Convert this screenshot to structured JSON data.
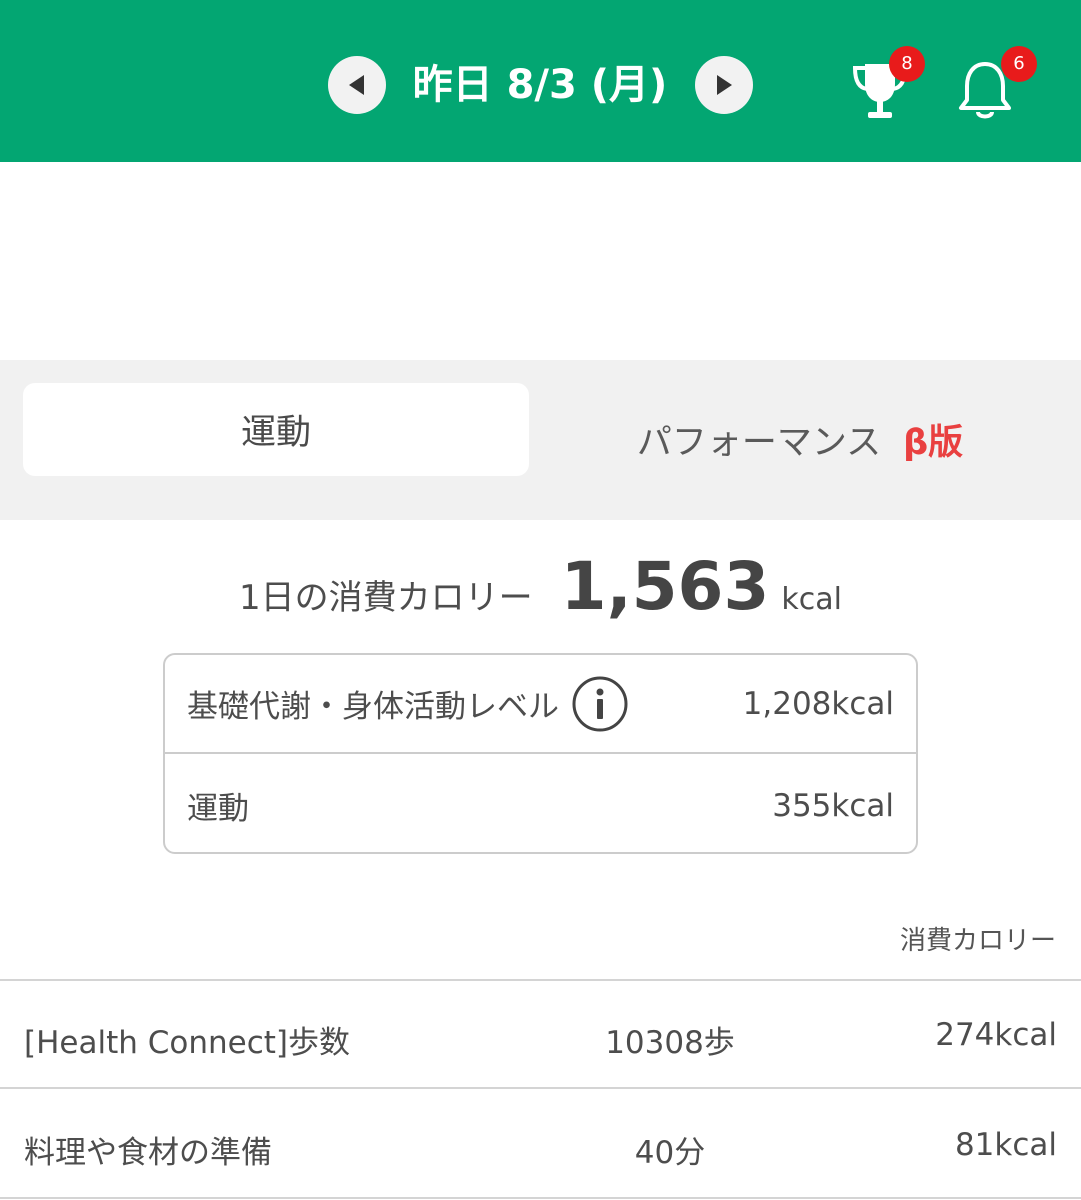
{
  "header": {
    "date_title": "昨日 8/3 (月)",
    "trophy_badge": "8",
    "bell_badge": "6",
    "bg_color": "#03a672"
  },
  "tabs": {
    "active_label": "運動",
    "inactive_label": "パフォーマンス",
    "beta_label": "β版"
  },
  "total": {
    "label": "1日の消費カロリー",
    "value": "1,563",
    "unit": "kcal"
  },
  "breakdown": [
    {
      "label": "基礎代謝・身体活動レベル",
      "value": "1,208kcal"
    },
    {
      "label": "運動",
      "value": "355kcal"
    }
  ],
  "list": {
    "column_header": "消費カロリー",
    "rows": [
      {
        "name": "[Health Connect]歩数",
        "amount": "10308歩",
        "kcal": "274kcal"
      },
      {
        "name": "料理や食材の準備",
        "amount": "40分",
        "kcal": "81kcal"
      }
    ]
  },
  "icons": {
    "prev": "chevron-left-icon",
    "next": "chevron-right-icon",
    "trophy": "trophy-icon",
    "bell": "bell-icon",
    "info": "info-icon"
  }
}
